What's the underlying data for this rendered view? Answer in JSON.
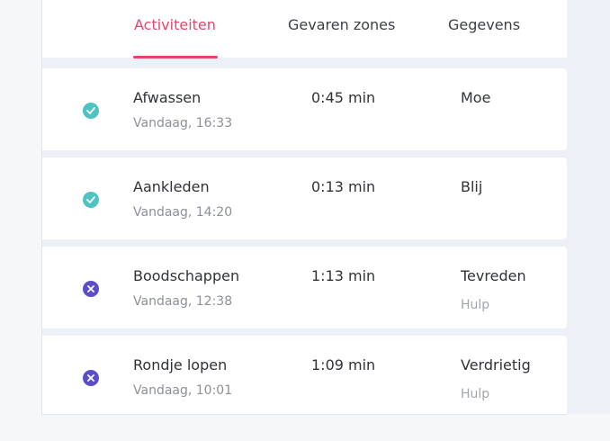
{
  "tabs": [
    {
      "label": "Activiteiten",
      "active": true
    },
    {
      "label": "Gevaren zones",
      "active": false
    },
    {
      "label": "Gegevens",
      "active": false
    }
  ],
  "colors": {
    "accent": "#e8456a",
    "success": "#4fc3c3",
    "failed": "#5b4fc9"
  },
  "activities": [
    {
      "title": "Afwassen",
      "time": "Vandaag, 16:33",
      "duration": "0:45 min",
      "mood": "Moe",
      "help": "",
      "status": "done",
      "icon": "check-circle-icon"
    },
    {
      "title": "Aankleden",
      "time": "Vandaag, 14:20",
      "duration": "0:13 min",
      "mood": "Blij",
      "help": "",
      "status": "done",
      "icon": "check-circle-icon"
    },
    {
      "title": "Boodschappen",
      "time": "Vandaag, 12:38",
      "duration": "1:13 min",
      "mood": "Tevreden",
      "help": "Hulp",
      "status": "failed",
      "icon": "x-circle-icon"
    },
    {
      "title": "Rondje lopen",
      "time": "Vandaag, 10:01",
      "duration": "1:09 min",
      "mood": "Verdrietig",
      "help": "Hulp",
      "status": "failed",
      "icon": "x-circle-icon"
    }
  ]
}
